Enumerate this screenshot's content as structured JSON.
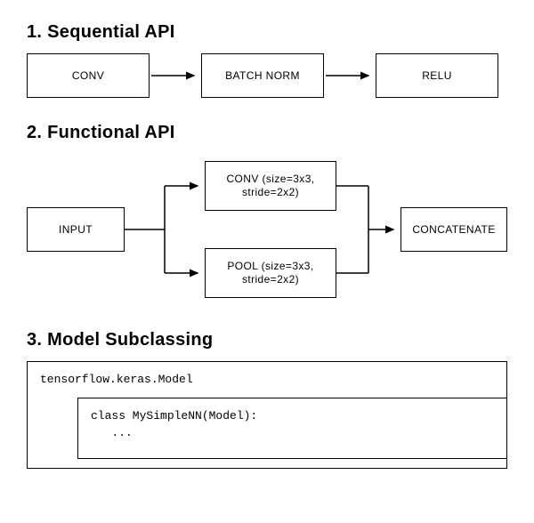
{
  "sections": {
    "sequential": {
      "heading": "1. Sequential API",
      "blocks": [
        "CONV",
        "BATCH NORM",
        "RELU"
      ]
    },
    "functional": {
      "heading": "2. Functional API",
      "input": "INPUT",
      "conv": "CONV (size=3x3,\nstride=2x2)",
      "pool": "POOL (size=3x3,\nstride=2x2)",
      "concat": "CONCATENATE"
    },
    "subclassing": {
      "heading": "3. Model Subclassing",
      "outer_label": "tensorflow.keras.Model",
      "inner_code": "class MySimpleNN(Model):\n   ..."
    }
  }
}
